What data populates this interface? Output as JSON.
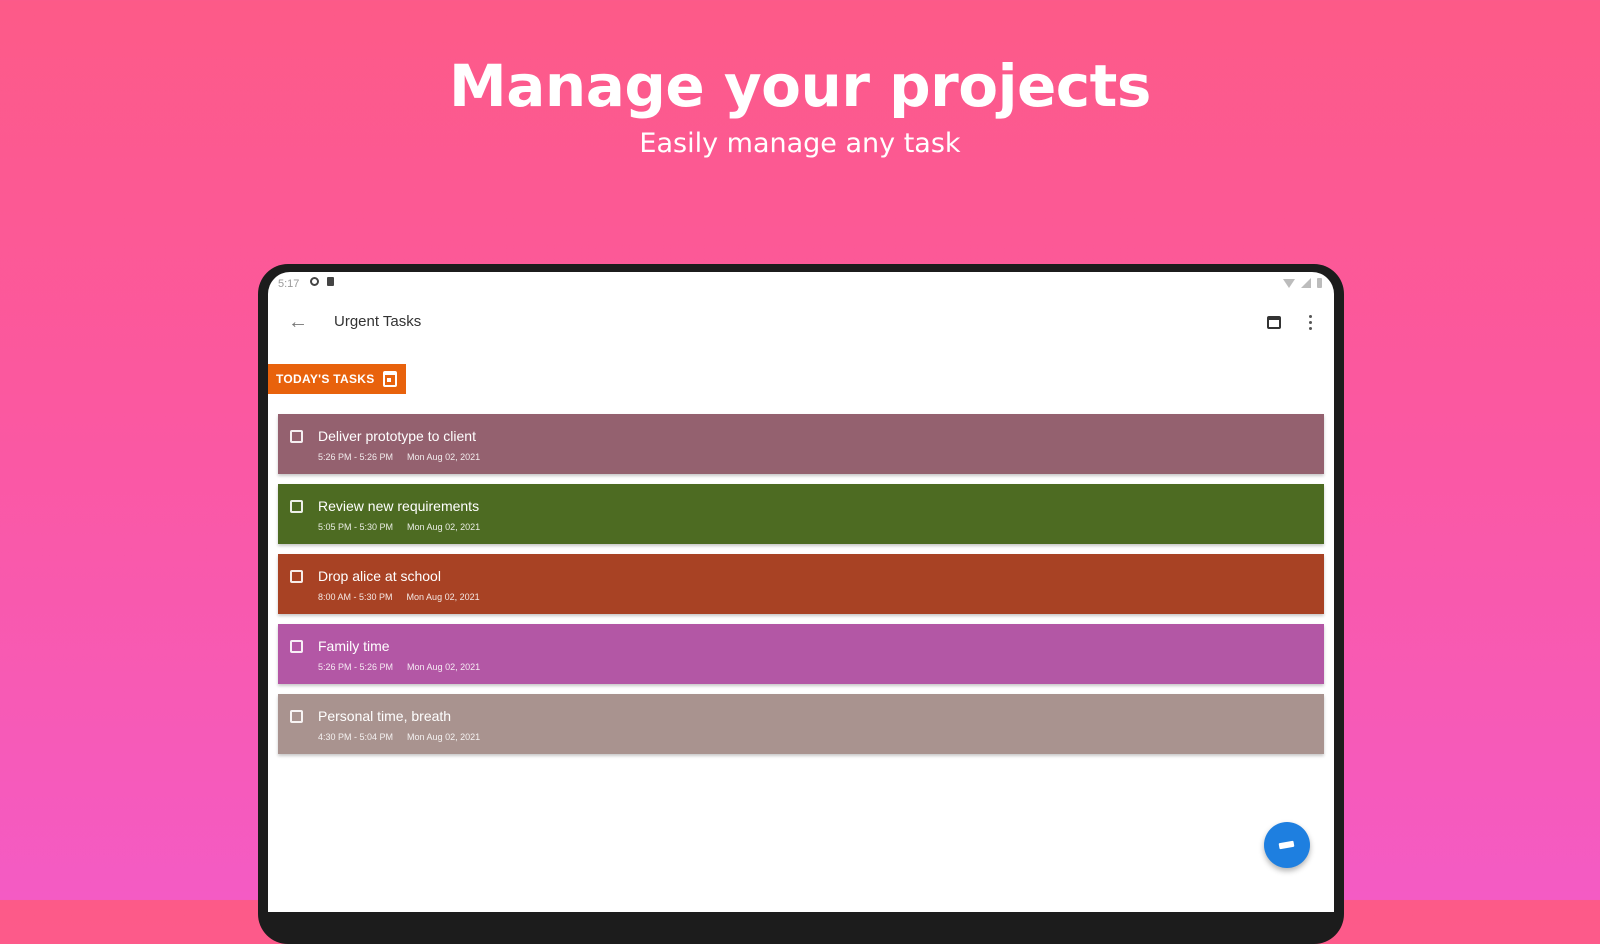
{
  "hero": {
    "title": "Manage your projects",
    "subtitle": "Easily manage any task"
  },
  "status_bar": {
    "time": "5:17"
  },
  "app_bar": {
    "title": "Urgent Tasks",
    "back_icon": "arrow-back-icon",
    "calendar_icon": "calendar-icon",
    "menu_icon": "more-vert-icon"
  },
  "section": {
    "label": "TODAY'S TASKS",
    "color": "#e8620c"
  },
  "tasks": [
    {
      "title": "Deliver prototype to client",
      "time": "5:26 PM - 5:26 PM",
      "date": "Mon Aug 02, 2021",
      "color": "#94616f"
    },
    {
      "title": "Review new requirements",
      "time": "5:05 PM - 5:30 PM",
      "date": "Mon Aug 02, 2021",
      "color": "#4d6b22"
    },
    {
      "title": "Drop alice at school",
      "time": "8:00 AM - 5:30 PM",
      "date": "Mon Aug 02, 2021",
      "color": "#a84224"
    },
    {
      "title": "Family time",
      "time": "5:26 PM - 5:26 PM",
      "date": "Mon Aug 02, 2021",
      "color": "#b357a5"
    },
    {
      "title": "Personal time, breath",
      "time": "4:30 PM - 5:04 PM",
      "date": "Mon Aug 02, 2021",
      "color": "#a9938f"
    }
  ],
  "fab": {
    "icon": "edit-icon",
    "color": "#1e7fe0"
  }
}
